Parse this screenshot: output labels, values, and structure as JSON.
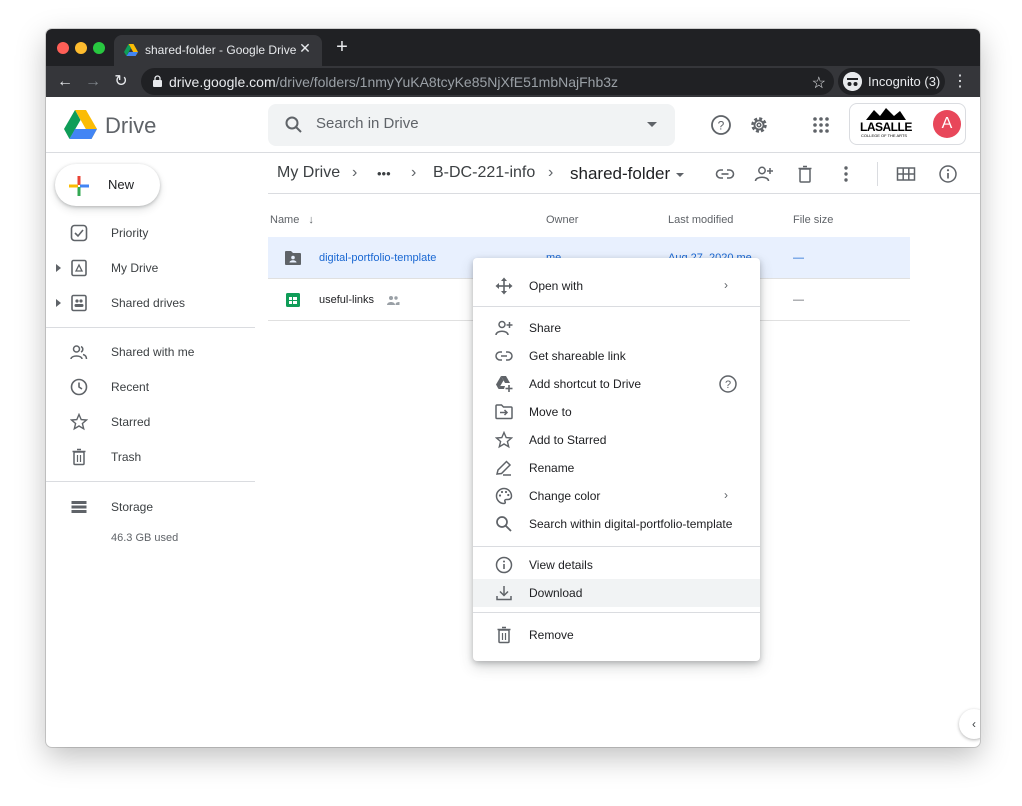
{
  "browser": {
    "tab_title": "shared-folder - Google Drive",
    "tab_close": "✕",
    "new_tab": "+",
    "url_host": "drive.google.com",
    "url_path": "/drive/folders/1nmyYuKA8tcyKe85NjXfE51mbNajFhb3z",
    "incognito_label": "Incognito (3)"
  },
  "header": {
    "product_name": "Drive",
    "search_placeholder": "Search in Drive",
    "org_logo_text": "LASALLE",
    "org_logo_subtext": "COLLEGE OF THE ARTS",
    "avatar_letter": "A"
  },
  "sidebar": {
    "new_label": "New",
    "items": [
      {
        "label": "Priority",
        "icon": "priority-icon"
      },
      {
        "label": "My Drive",
        "icon": "my-drive-icon"
      },
      {
        "label": "Shared drives",
        "icon": "shared-drives-icon"
      },
      {
        "label": "Shared with me",
        "icon": "shared-with-me-icon"
      },
      {
        "label": "Recent",
        "icon": "clock-icon"
      },
      {
        "label": "Starred",
        "icon": "star-icon"
      },
      {
        "label": "Trash",
        "icon": "trash-icon"
      },
      {
        "label": "Storage",
        "icon": "storage-icon"
      }
    ],
    "storage_used": "46.3 GB used"
  },
  "breadcrumb": {
    "root": "My Drive",
    "ellipsis": "•••",
    "parent": "B-DC-221-info",
    "current": "shared-folder"
  },
  "list": {
    "columns": [
      "Name",
      "Owner",
      "Last modified",
      "File size"
    ],
    "rows": [
      {
        "name": "digital-portfolio-template",
        "owner": "me",
        "modified": "Aug 27, 2020 me",
        "size": "—",
        "type": "shared-folder",
        "selected": true
      },
      {
        "name": "useful-links",
        "owner": "",
        "modified": "",
        "size": "—",
        "type": "spreadsheet",
        "selected": false
      }
    ]
  },
  "context_menu": {
    "items": [
      {
        "label": "Open with",
        "icon": "open-with-icon",
        "submenu": true
      },
      {
        "label": "Share",
        "icon": "share-icon"
      },
      {
        "label": "Get shareable link",
        "icon": "link-icon"
      },
      {
        "label": "Add shortcut to Drive",
        "icon": "add-shortcut-icon",
        "help": true
      },
      {
        "label": "Move to",
        "icon": "move-to-icon"
      },
      {
        "label": "Add to Starred",
        "icon": "star-outline-icon"
      },
      {
        "label": "Rename",
        "icon": "rename-icon"
      },
      {
        "label": "Change color",
        "icon": "palette-icon",
        "submenu": true
      },
      {
        "label": "Search within digital-portfolio-template",
        "icon": "search-icon"
      },
      {
        "label": "View details",
        "icon": "info-icon"
      },
      {
        "label": "Download",
        "icon": "download-icon",
        "highlighted": true
      },
      {
        "label": "Remove",
        "icon": "trash-icon"
      }
    ],
    "submenu_arrow": "›"
  },
  "colors": {
    "accent": "#1967d2",
    "selected_row": "#e8f0fe",
    "avatar": "#e8475a",
    "chrome_dark": "#202124"
  }
}
